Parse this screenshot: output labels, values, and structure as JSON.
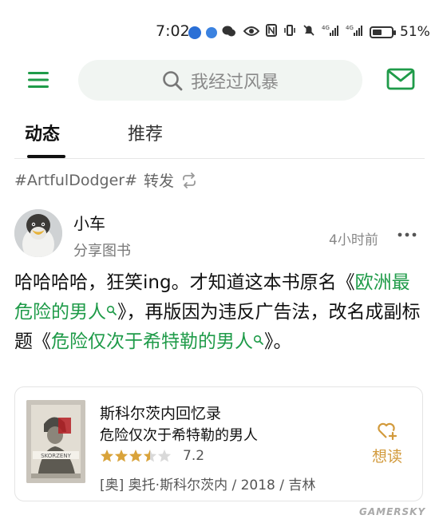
{
  "status_bar": {
    "time": "7:02",
    "network_1": "4G",
    "network_2": "4G",
    "battery_level": 0.51,
    "battery_text": "51%"
  },
  "search": {
    "placeholder": "我经过风暴",
    "icons": {
      "left": "menu-icon",
      "search": "search-icon",
      "right": "mail-icon"
    }
  },
  "tabs": [
    {
      "label": "动态",
      "active": true
    },
    {
      "label": "推荐",
      "active": false
    }
  ],
  "repost": {
    "tag": "#ArtfulDodger#",
    "action": "转发",
    "icon": "repost-icon"
  },
  "post": {
    "author": "小车",
    "action": "分享图书",
    "time": "4小时前",
    "text_1": "哈哈哈哈，狂笑ing。才知道这本书原名",
    "open_quote_1": "《",
    "link_1": "欧洲最危险的男人",
    "close_1": "》，再版因为违反广告法，改名成副标题",
    "open_quote_2": "《",
    "link_2": "危险仅次于希特勒的男人",
    "close_2": "》。"
  },
  "book": {
    "title": "斯科尔茨内回忆录",
    "subtitle": "危险仅次于希特勒的男人",
    "rating": 7.2,
    "rating_text": "7.2",
    "stars_out_of_5": 3.5,
    "meta": "[奥] 奥托·斯科尔茨内 / 2018 / 吉林",
    "want_label": "想读",
    "cover_text": "SKORZENY"
  },
  "colors": {
    "accent_green": "#1f9b49",
    "want_gold": "#d29a3c",
    "star_gold": "#d9a33a",
    "star_empty": "#d9d9d9"
  },
  "watermark": "GAMERSKY"
}
